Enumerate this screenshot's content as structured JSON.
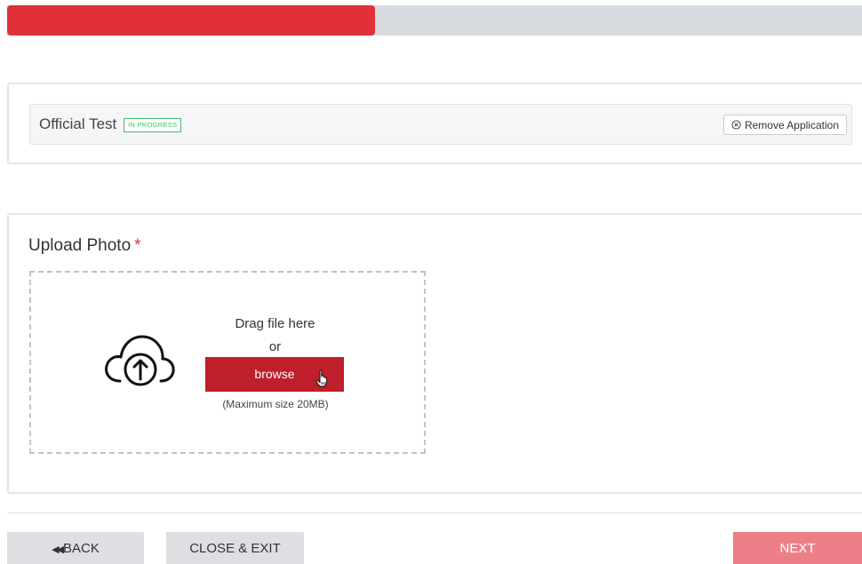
{
  "progress": {
    "fraction": 0.43
  },
  "application": {
    "name": "Official Test",
    "status": "IN PROGRESS",
    "remove_label": "Remove Application"
  },
  "upload": {
    "title": "Upload Photo",
    "required_mark": "*",
    "drag_text": "Drag file here",
    "or_text": "or",
    "browse_label": "browse",
    "max_size_text": "(Maximum size 20MB)"
  },
  "footer": {
    "back_arrow": "◀◀",
    "back_label": "BACK",
    "close_label": "CLOSE & EXIT",
    "next_label": "NEXT"
  },
  "colors": {
    "accent": "#e0303a",
    "browse": "#be1f2b",
    "next_disabled": "#ec7f86",
    "status_green": "#47b86a"
  },
  "icons": {
    "remove": "circle-x-icon",
    "upload": "cloud-upload-icon",
    "cursor": "hand-pointer-icon",
    "back": "double-chevron-left-icon"
  }
}
